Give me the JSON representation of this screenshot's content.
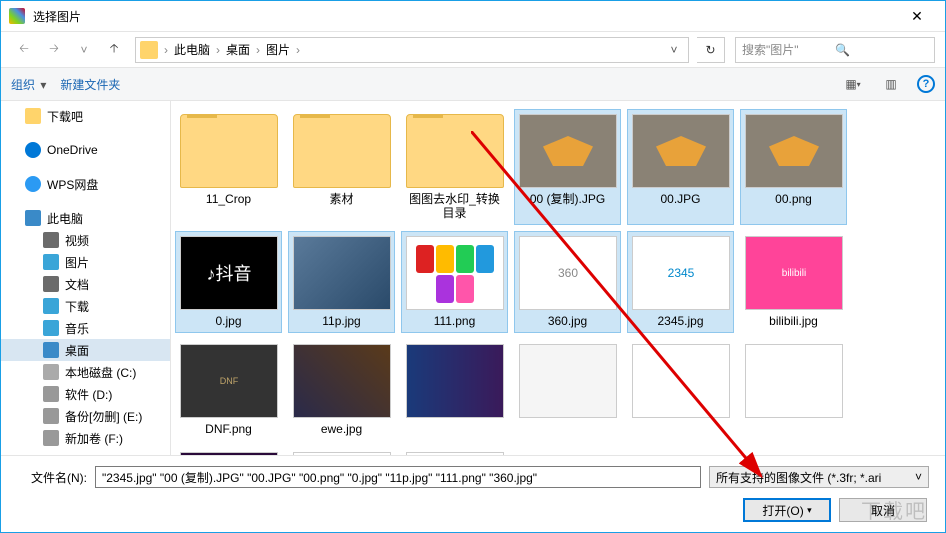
{
  "window": {
    "title": "选择图片"
  },
  "breadcrumb": {
    "items": [
      "此电脑",
      "桌面",
      "图片"
    ]
  },
  "search": {
    "placeholder": "搜索\"图片\""
  },
  "toolbar": {
    "organize": "组织",
    "newfolder": "新建文件夹"
  },
  "tree": {
    "download": "下载吧",
    "onedrive": "OneDrive",
    "wps": "WPS网盘",
    "pc": "此电脑",
    "video": "视频",
    "image": "图片",
    "doc": "文档",
    "dl": "下载",
    "music": "音乐",
    "desktop": "桌面",
    "c": "本地磁盘 (C:)",
    "d": "软件 (D:)",
    "e": "备份[勿删] (E:)",
    "f": "新加卷 (F:)"
  },
  "items": [
    {
      "name": "11_Crop",
      "type": "folder",
      "sel": false
    },
    {
      "name": "素材",
      "type": "folder",
      "sel": false
    },
    {
      "name": "图图去水印_转换目录",
      "type": "folder-img",
      "sel": false
    },
    {
      "name": "00 (复制).JPG",
      "type": "badge",
      "sel": true
    },
    {
      "name": "00.JPG",
      "type": "badge",
      "sel": true
    },
    {
      "name": "00.png",
      "type": "badge",
      "sel": true
    },
    {
      "name": "0.jpg",
      "type": "tiktok",
      "sel": true
    },
    {
      "name": "11p.jpg",
      "type": "phone",
      "sel": true
    },
    {
      "name": "111.png",
      "type": "colors",
      "sel": true
    },
    {
      "name": "360.jpg",
      "type": "w360",
      "sel": true
    },
    {
      "name": "2345.jpg",
      "type": "w2345",
      "sel": true
    },
    {
      "name": "bilibili.jpg",
      "type": "bili",
      "sel": false
    },
    {
      "name": "DNF.png",
      "type": "dnf",
      "sel": false
    },
    {
      "name": "ewe.jpg",
      "type": "ewe",
      "sel": false
    },
    {
      "name": "",
      "type": "crop1",
      "sel": false
    },
    {
      "name": "",
      "type": "ipad",
      "sel": false
    },
    {
      "name": "",
      "type": "oppo",
      "sel": false
    },
    {
      "name": "",
      "type": "huawei",
      "sel": false
    },
    {
      "name": "",
      "type": "pr",
      "sel": false
    },
    {
      "name": "",
      "type": "qq",
      "sel": false
    },
    {
      "name": "",
      "type": "qq",
      "sel": false
    }
  ],
  "footer": {
    "filelabel": "文件名(N):",
    "filename": "\"2345.jpg\" \"00 (复制).JPG\" \"00.JPG\" \"00.png\" \"0.jpg\" \"11p.jpg\" \"111.png\" \"360.jpg\"",
    "filetype": "所有支持的图像文件 (*.3fr; *.ari",
    "open": "打开(O)",
    "cancel": "取消"
  },
  "watermark": "下载吧"
}
